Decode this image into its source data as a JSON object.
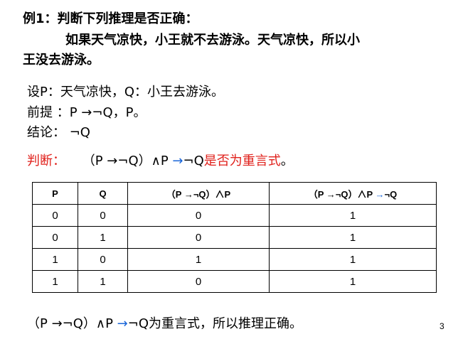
{
  "example": {
    "line1": "例1：判断下列推理是否正确：",
    "line2": "如果天气凉快，小王就不去游泳。天气凉快，所以小",
    "line3": "王没去游泳。"
  },
  "setup": {
    "let": "设P：天气凉快，Q：小王去游泳。",
    "premise": "前提 ：P →¬Q，P。",
    "conclusion": "结论： ¬Q"
  },
  "judgment": {
    "label": "判断：",
    "formula_part1": "（P →¬Q）∧P ",
    "arrow": "→",
    "formula_part2": "¬Q",
    "suffix": "是否为重言式",
    "end": "。"
  },
  "truth_table": {
    "headers": {
      "p": "P",
      "q": "Q",
      "c3": "（P →¬Q）∧P",
      "c4_part1": "（P →¬Q）∧P ",
      "c4_arrow": "→",
      "c4_part2": "¬Q"
    },
    "rows": [
      {
        "p": "0",
        "q": "0",
        "c3": "0",
        "c4": "1"
      },
      {
        "p": "0",
        "q": "1",
        "c3": "0",
        "c4": "1"
      },
      {
        "p": "1",
        "q": "0",
        "c3": "1",
        "c4": "1"
      },
      {
        "p": "1",
        "q": "1",
        "c3": "0",
        "c4": "1"
      }
    ]
  },
  "result": {
    "formula_part1": "（P →¬Q）∧P ",
    "arrow": "→",
    "formula_part2": "¬Q",
    "text": "为重言式，所以推理正确。"
  },
  "page_number": "3",
  "colors": {
    "red": "#e0201b",
    "blue": "#1a66d9"
  }
}
